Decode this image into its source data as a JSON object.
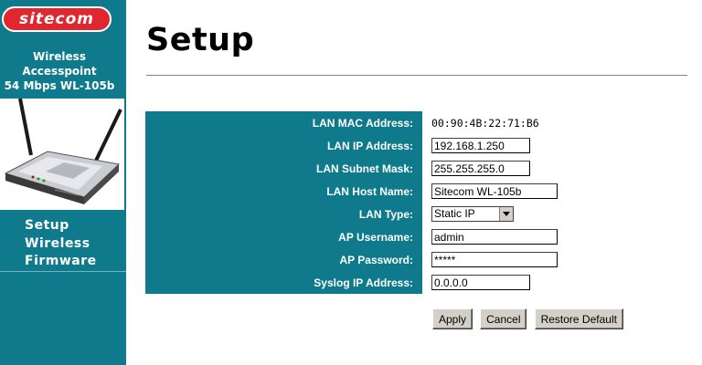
{
  "brand": {
    "logo_text": "sitecom"
  },
  "product": {
    "line1": "Wireless",
    "line2": "Accesspoint",
    "line3": "54 Mbps WL-105b"
  },
  "sidebar": {
    "items": [
      {
        "label": "Setup"
      },
      {
        "label": "Wireless"
      },
      {
        "label": "Firmware"
      }
    ]
  },
  "page": {
    "title": "Setup"
  },
  "form": {
    "mac_label": "LAN MAC Address:",
    "mac_value": "00:90:4B:22:71:B6",
    "ip_label": "LAN IP Address:",
    "ip_value": "192.168.1.250",
    "mask_label": "LAN Subnet Mask:",
    "mask_value": "255.255.255.0",
    "host_label": "LAN Host Name:",
    "host_value": "Sitecom WL-105b",
    "type_label": "LAN Type:",
    "type_value": "Static IP",
    "user_label": "AP Username:",
    "user_value": "admin",
    "pass_label": "AP Password:",
    "pass_value": "*****",
    "syslog_label": "Syslog IP Address:",
    "syslog_value": "0.0.0.0"
  },
  "buttons": {
    "apply": "Apply",
    "cancel": "Cancel",
    "restore": "Restore Default"
  },
  "colors": {
    "sidebar": "#0e7a8b",
    "logo": "#e0272f",
    "button_face": "#d4d0c8"
  },
  "icons": {
    "product_image": "wireless-router-image"
  }
}
